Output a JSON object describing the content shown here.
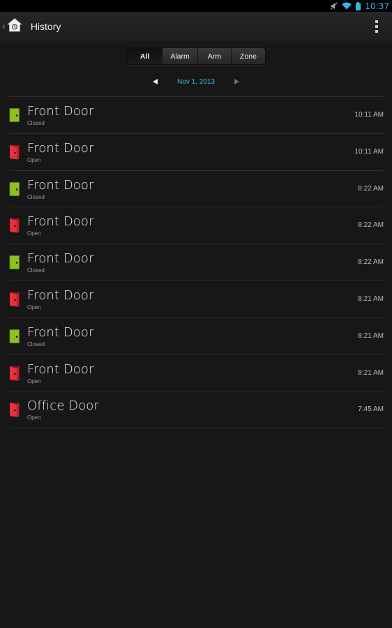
{
  "status_bar": {
    "time": "10:37",
    "icons": [
      "mute-icon",
      "wifi-icon",
      "battery-icon"
    ],
    "accent_color": "#33b5e5"
  },
  "action_bar": {
    "title": "History",
    "home_icon": "home-icon",
    "up_caret": "‹",
    "menu_icon": "overflow-menu-icon"
  },
  "filters": {
    "options": [
      "All",
      "Alarm",
      "Arm",
      "Zone"
    ],
    "selected": "All"
  },
  "date_nav": {
    "date": "Nov 1, 2013",
    "prev_icon": "previous-day-icon",
    "next_icon": "next-day-icon"
  },
  "colors": {
    "closed": "#8dc21f",
    "open": "#e8303b",
    "date_accent": "#33b5e5"
  },
  "events": [
    {
      "title": "Front Door",
      "status": "Closed",
      "time": "10:11 AM",
      "icon": "door-closed-icon",
      "state": "closed"
    },
    {
      "title": "Front Door",
      "status": "Open",
      "time": "10:11 AM",
      "icon": "door-open-icon",
      "state": "open"
    },
    {
      "title": "Front Door",
      "status": "Closed",
      "time": "8:22 AM",
      "icon": "door-closed-icon",
      "state": "closed"
    },
    {
      "title": "Front Door",
      "status": "Open",
      "time": "8:22 AM",
      "icon": "door-open-icon",
      "state": "open"
    },
    {
      "title": "Front Door",
      "status": "Closed",
      "time": "8:22 AM",
      "icon": "door-closed-icon",
      "state": "closed"
    },
    {
      "title": "Front Door",
      "status": "Open",
      "time": "8:21 AM",
      "icon": "door-open-icon",
      "state": "open"
    },
    {
      "title": "Front Door",
      "status": "Closed",
      "time": "8:21 AM",
      "icon": "door-closed-icon",
      "state": "closed"
    },
    {
      "title": "Front Door",
      "status": "Open",
      "time": "8:21 AM",
      "icon": "door-open-icon",
      "state": "open"
    },
    {
      "title": "Office Door",
      "status": "Open",
      "time": "7:45 AM",
      "icon": "door-open-icon",
      "state": "open"
    }
  ]
}
